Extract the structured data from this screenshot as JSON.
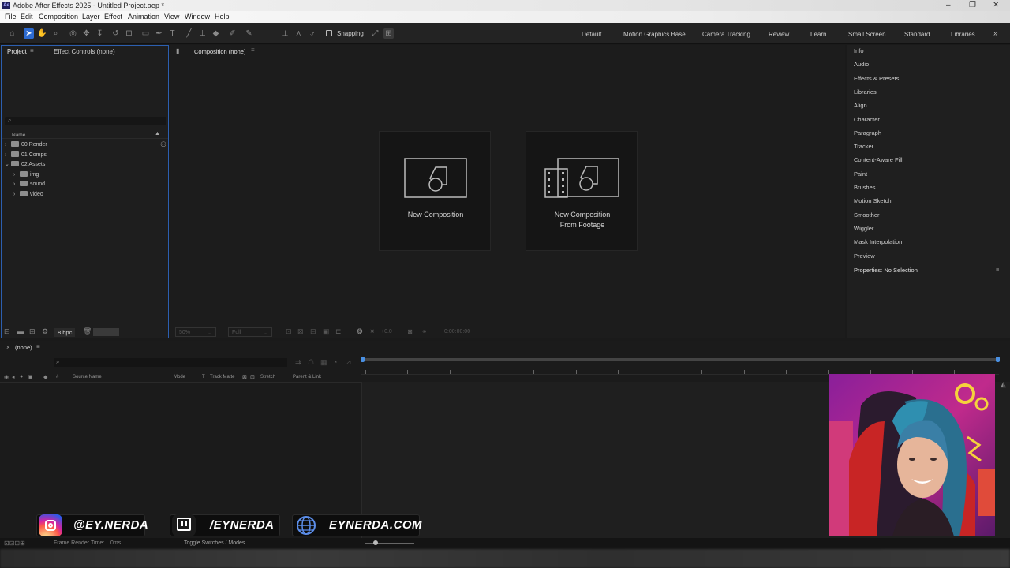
{
  "window": {
    "title": "Adobe After Effects 2025 - Untitled Project.aep *",
    "logo": "Ae"
  },
  "menu": [
    "File",
    "Edit",
    "Composition",
    "Layer",
    "Effect",
    "Animation",
    "View",
    "Window",
    "Help"
  ],
  "toolbar": {
    "snapping_label": "Snapping",
    "workspaces": [
      "Default",
      "Motion Graphics Base",
      "Camera Tracking",
      "Review",
      "Learn",
      "Small Screen",
      "Standard",
      "Libraries"
    ],
    "more": "»"
  },
  "project_panel": {
    "tabs": [
      "Project",
      "Effect Controls (none)"
    ],
    "search_placeholder": "",
    "column_name": "Name",
    "items": [
      {
        "label": "00 Render",
        "indent": 0,
        "expanded": false
      },
      {
        "label": "01 Comps",
        "indent": 0,
        "expanded": false
      },
      {
        "label": "02 Assets",
        "indent": 0,
        "expanded": true
      },
      {
        "label": "img",
        "indent": 1,
        "expanded": false
      },
      {
        "label": "sound",
        "indent": 1,
        "expanded": false
      },
      {
        "label": "video",
        "indent": 1,
        "expanded": false
      }
    ],
    "bpc": "8 bpc"
  },
  "composition_panel": {
    "tab": "Composition (none)",
    "new_comp_label": "New Composition",
    "new_comp_footage_line1": "New Composition",
    "new_comp_footage_line2": "From Footage",
    "zoom": "50%",
    "resolution": "Full",
    "exposure": "+0.0",
    "timecode": "0:00:00:00"
  },
  "right_panel": {
    "items": [
      "Info",
      "Audio",
      "Effects & Presets",
      "Libraries",
      "Align",
      "Character",
      "Paragraph",
      "Tracker",
      "Content-Aware Fill",
      "Paint",
      "Brushes",
      "Motion Sketch",
      "Smoother",
      "Wiggler",
      "Mask Interpolation",
      "Preview"
    ],
    "properties": "Properties: No Selection"
  },
  "timeline": {
    "tab": "(none)",
    "columns": {
      "source": "Source Name",
      "mode": "Mode",
      "t": "T",
      "track_matte": "Track Matte",
      "stretch": "Stretch",
      "parent": "Parent & Link"
    },
    "frame_render": "Frame Render Time:",
    "frame_render_value": "0ms",
    "toggle": "Toggle Switches / Modes"
  },
  "overlay": {
    "instagram": "@EY.NERDA",
    "twitch": "/EYNERDA",
    "website": "EYNERDA.COM"
  },
  "colors": {
    "accent": "#2d6bd1",
    "panel_border": "#2c5fb0"
  }
}
